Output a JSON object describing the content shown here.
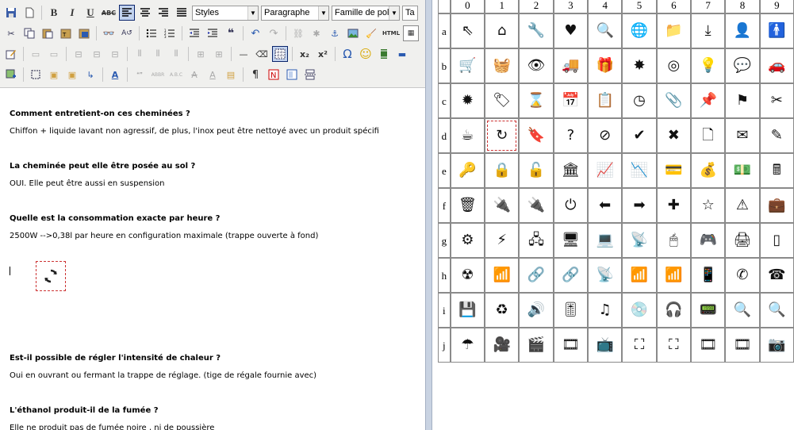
{
  "toolbar": {
    "styles_label": "Styles",
    "format_label": "Paragraphe",
    "font_family_label": "Famille de police",
    "font_size_label": "Ta",
    "html_label": "HTML",
    "abc_label": "ABC",
    "bold_label": "B",
    "italic_label": "I",
    "underline_label": "U",
    "subscript_label": "x₂",
    "superscript_label": "x²",
    "omega_label": "Ω",
    "smiley_label": "☺",
    "pilcrow_label": "¶"
  },
  "content": {
    "q1": "Comment entretient-on ces cheminées ?",
    "a1": "Chiffon + liquide lavant non agressif, de plus, l'inox peut être nettoyé avec un produit spécifi",
    "q2": "La cheminée  peut elle être posée au sol ?",
    "a2": "OUI. Elle peut être aussi en suspension",
    "q3": "Quelle est la consommation exacte par heure ?",
    "a3": "2500W -->0,38l par heure en configuration maximale (trappe ouverte à fond)",
    "q4": "Est-il possible de régler l'intensité de chaleur ?",
    "a4": "Oui en ouvrant ou fermant la trappe de réglage. (tige de régale fournie avec)",
    "q5": "L'éthanol produit-il de la fumée ?",
    "a5": "Elle ne produit pas de fumée noire , ni de poussière",
    "inserted_image_icon": "refresh-icon"
  },
  "grid": {
    "columns": [
      "0",
      "1",
      "2",
      "3",
      "4",
      "5",
      "6",
      "7",
      "8",
      "9"
    ],
    "rows": [
      {
        "label": "a",
        "cells": [
          "⇖",
          "⌂",
          "🔧",
          "♥",
          "🔍",
          "🌐",
          "📁",
          "⤓",
          "👤",
          "🚹"
        ]
      },
      {
        "label": "b",
        "cells": [
          "🛒",
          "🧺",
          "👁",
          "🚚",
          "🎁",
          "✸",
          "◎",
          "💡",
          "💬",
          "🚗"
        ]
      },
      {
        "label": "c",
        "cells": [
          "✹",
          "🏷",
          "⌛",
          "📅",
          "📋",
          "◷",
          "📎",
          "📌",
          "⚑",
          "✂"
        ]
      },
      {
        "label": "d",
        "cells": [
          "☕",
          "↻",
          "🔖",
          "?",
          "⊘",
          "✔",
          "✖",
          "🗋",
          "✉",
          "✎"
        ]
      },
      {
        "label": "e",
        "cells": [
          "🔑",
          "🔒",
          "🔓",
          "🏛",
          "📈",
          "📉",
          "💳",
          "💰",
          "💵",
          "🖩"
        ]
      },
      {
        "label": "f",
        "cells": [
          "🗑",
          "🔌",
          "🔌",
          "⏻",
          "⬅",
          "➡",
          "✚",
          "☆",
          "⚠",
          "💼"
        ]
      },
      {
        "label": "g",
        "cells": [
          "⚙",
          "⚡",
          "🖧",
          "🖥",
          "💻",
          "📡",
          "🖱",
          "🎮",
          "🖨",
          "▯"
        ]
      },
      {
        "label": "h",
        "cells": [
          "☢",
          "📶",
          "🔗",
          "🔗",
          "📡",
          "📶",
          "📶",
          "📱",
          "✆",
          "☎"
        ]
      },
      {
        "label": "i",
        "cells": [
          "💾",
          "♻",
          "🔊",
          "🎚",
          "♫",
          "💿",
          "🎧",
          "📟",
          "🔍",
          "🔍"
        ]
      },
      {
        "label": "j",
        "cells": [
          "☂",
          "🎥",
          "🎬",
          "🎞",
          "📺",
          "⛶",
          "⛶",
          "🎞",
          "🎞",
          "📷"
        ]
      }
    ],
    "highlighted_cell": "d1"
  }
}
